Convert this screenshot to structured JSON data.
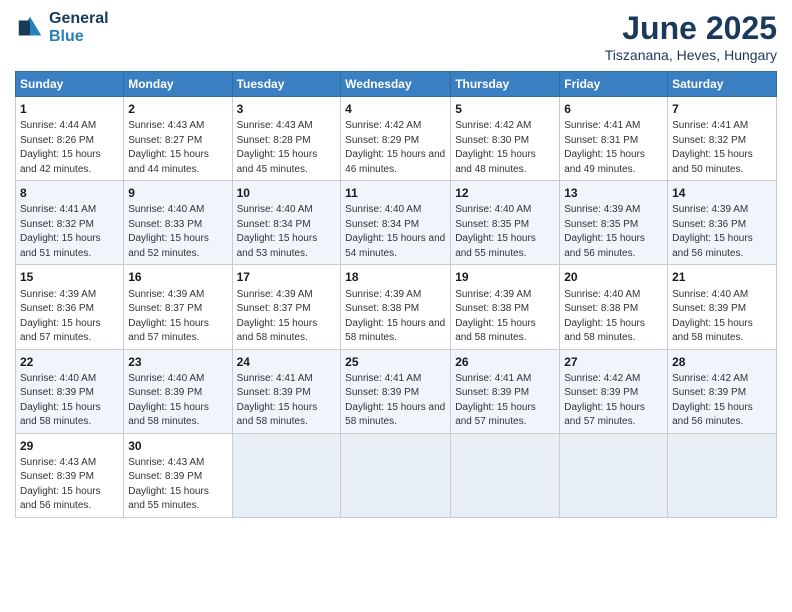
{
  "logo": {
    "general": "General",
    "blue": "Blue"
  },
  "title": "June 2025",
  "location": "Tiszanana, Heves, Hungary",
  "days_of_week": [
    "Sunday",
    "Monday",
    "Tuesday",
    "Wednesday",
    "Thursday",
    "Friday",
    "Saturday"
  ],
  "weeks": [
    [
      {
        "day": "1",
        "sunrise": "Sunrise: 4:44 AM",
        "sunset": "Sunset: 8:26 PM",
        "daylight": "Daylight: 15 hours and 42 minutes."
      },
      {
        "day": "2",
        "sunrise": "Sunrise: 4:43 AM",
        "sunset": "Sunset: 8:27 PM",
        "daylight": "Daylight: 15 hours and 44 minutes."
      },
      {
        "day": "3",
        "sunrise": "Sunrise: 4:43 AM",
        "sunset": "Sunset: 8:28 PM",
        "daylight": "Daylight: 15 hours and 45 minutes."
      },
      {
        "day": "4",
        "sunrise": "Sunrise: 4:42 AM",
        "sunset": "Sunset: 8:29 PM",
        "daylight": "Daylight: 15 hours and 46 minutes."
      },
      {
        "day": "5",
        "sunrise": "Sunrise: 4:42 AM",
        "sunset": "Sunset: 8:30 PM",
        "daylight": "Daylight: 15 hours and 48 minutes."
      },
      {
        "day": "6",
        "sunrise": "Sunrise: 4:41 AM",
        "sunset": "Sunset: 8:31 PM",
        "daylight": "Daylight: 15 hours and 49 minutes."
      },
      {
        "day": "7",
        "sunrise": "Sunrise: 4:41 AM",
        "sunset": "Sunset: 8:32 PM",
        "daylight": "Daylight: 15 hours and 50 minutes."
      }
    ],
    [
      {
        "day": "8",
        "sunrise": "Sunrise: 4:41 AM",
        "sunset": "Sunset: 8:32 PM",
        "daylight": "Daylight: 15 hours and 51 minutes."
      },
      {
        "day": "9",
        "sunrise": "Sunrise: 4:40 AM",
        "sunset": "Sunset: 8:33 PM",
        "daylight": "Daylight: 15 hours and 52 minutes."
      },
      {
        "day": "10",
        "sunrise": "Sunrise: 4:40 AM",
        "sunset": "Sunset: 8:34 PM",
        "daylight": "Daylight: 15 hours and 53 minutes."
      },
      {
        "day": "11",
        "sunrise": "Sunrise: 4:40 AM",
        "sunset": "Sunset: 8:34 PM",
        "daylight": "Daylight: 15 hours and 54 minutes."
      },
      {
        "day": "12",
        "sunrise": "Sunrise: 4:40 AM",
        "sunset": "Sunset: 8:35 PM",
        "daylight": "Daylight: 15 hours and 55 minutes."
      },
      {
        "day": "13",
        "sunrise": "Sunrise: 4:39 AM",
        "sunset": "Sunset: 8:35 PM",
        "daylight": "Daylight: 15 hours and 56 minutes."
      },
      {
        "day": "14",
        "sunrise": "Sunrise: 4:39 AM",
        "sunset": "Sunset: 8:36 PM",
        "daylight": "Daylight: 15 hours and 56 minutes."
      }
    ],
    [
      {
        "day": "15",
        "sunrise": "Sunrise: 4:39 AM",
        "sunset": "Sunset: 8:36 PM",
        "daylight": "Daylight: 15 hours and 57 minutes."
      },
      {
        "day": "16",
        "sunrise": "Sunrise: 4:39 AM",
        "sunset": "Sunset: 8:37 PM",
        "daylight": "Daylight: 15 hours and 57 minutes."
      },
      {
        "day": "17",
        "sunrise": "Sunrise: 4:39 AM",
        "sunset": "Sunset: 8:37 PM",
        "daylight": "Daylight: 15 hours and 58 minutes."
      },
      {
        "day": "18",
        "sunrise": "Sunrise: 4:39 AM",
        "sunset": "Sunset: 8:38 PM",
        "daylight": "Daylight: 15 hours and 58 minutes."
      },
      {
        "day": "19",
        "sunrise": "Sunrise: 4:39 AM",
        "sunset": "Sunset: 8:38 PM",
        "daylight": "Daylight: 15 hours and 58 minutes."
      },
      {
        "day": "20",
        "sunrise": "Sunrise: 4:40 AM",
        "sunset": "Sunset: 8:38 PM",
        "daylight": "Daylight: 15 hours and 58 minutes."
      },
      {
        "day": "21",
        "sunrise": "Sunrise: 4:40 AM",
        "sunset": "Sunset: 8:39 PM",
        "daylight": "Daylight: 15 hours and 58 minutes."
      }
    ],
    [
      {
        "day": "22",
        "sunrise": "Sunrise: 4:40 AM",
        "sunset": "Sunset: 8:39 PM",
        "daylight": "Daylight: 15 hours and 58 minutes."
      },
      {
        "day": "23",
        "sunrise": "Sunrise: 4:40 AM",
        "sunset": "Sunset: 8:39 PM",
        "daylight": "Daylight: 15 hours and 58 minutes."
      },
      {
        "day": "24",
        "sunrise": "Sunrise: 4:41 AM",
        "sunset": "Sunset: 8:39 PM",
        "daylight": "Daylight: 15 hours and 58 minutes."
      },
      {
        "day": "25",
        "sunrise": "Sunrise: 4:41 AM",
        "sunset": "Sunset: 8:39 PM",
        "daylight": "Daylight: 15 hours and 58 minutes."
      },
      {
        "day": "26",
        "sunrise": "Sunrise: 4:41 AM",
        "sunset": "Sunset: 8:39 PM",
        "daylight": "Daylight: 15 hours and 57 minutes."
      },
      {
        "day": "27",
        "sunrise": "Sunrise: 4:42 AM",
        "sunset": "Sunset: 8:39 PM",
        "daylight": "Daylight: 15 hours and 57 minutes."
      },
      {
        "day": "28",
        "sunrise": "Sunrise: 4:42 AM",
        "sunset": "Sunset: 8:39 PM",
        "daylight": "Daylight: 15 hours and 56 minutes."
      }
    ],
    [
      {
        "day": "29",
        "sunrise": "Sunrise: 4:43 AM",
        "sunset": "Sunset: 8:39 PM",
        "daylight": "Daylight: 15 hours and 56 minutes."
      },
      {
        "day": "30",
        "sunrise": "Sunrise: 4:43 AM",
        "sunset": "Sunset: 8:39 PM",
        "daylight": "Daylight: 15 hours and 55 minutes."
      },
      null,
      null,
      null,
      null,
      null
    ]
  ]
}
